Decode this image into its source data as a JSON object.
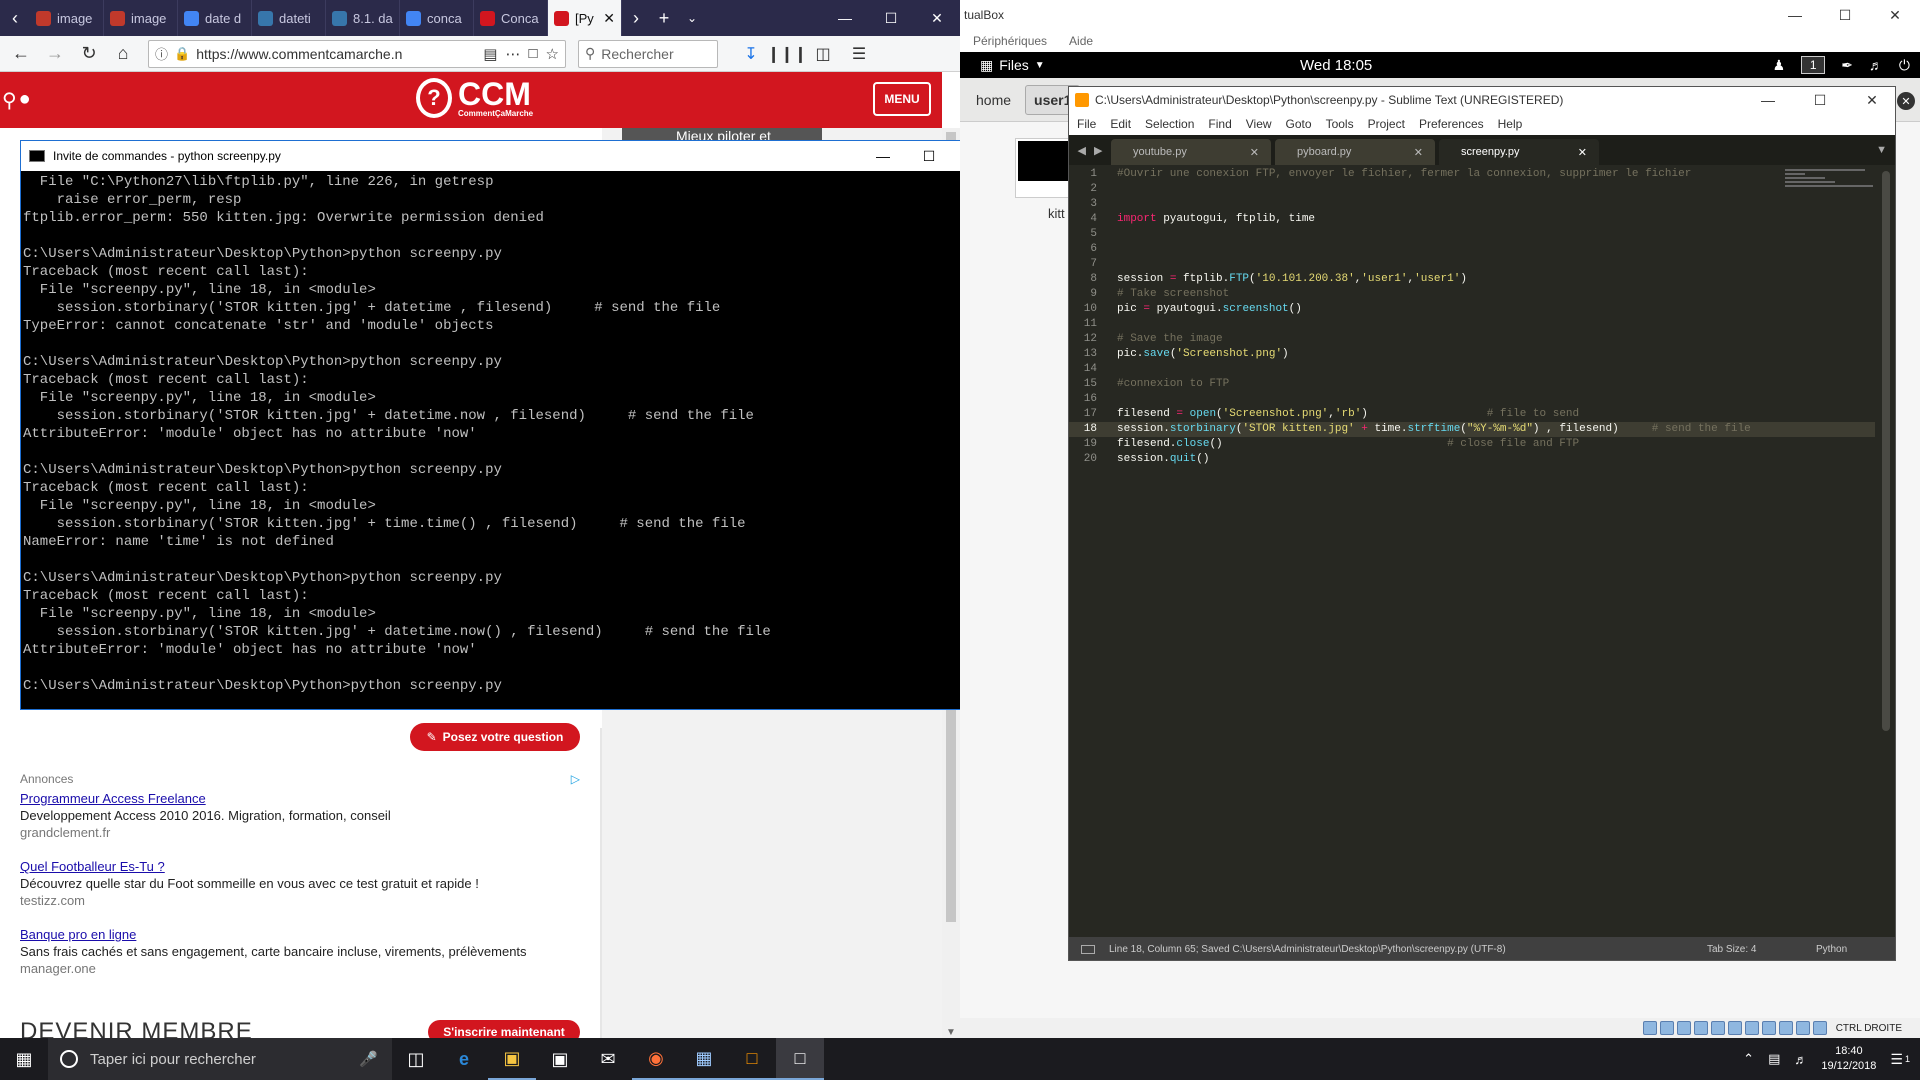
{
  "firefox": {
    "tabs": [
      {
        "label": "image",
        "color": "#c0392b"
      },
      {
        "label": "image",
        "color": "#c0392b"
      },
      {
        "label": "date d",
        "color": "#4285f4"
      },
      {
        "label": "dateti",
        "color": "#3776ab"
      },
      {
        "label": "8.1. da",
        "color": "#3776ab"
      },
      {
        "label": "conca",
        "color": "#4285f4"
      },
      {
        "label": "Conca",
        "color": "#d2161f"
      },
      {
        "label": "[Py",
        "color": "#d2161f",
        "active": true
      }
    ],
    "url": "https://www.commentcamarche.n",
    "search_placeholder": "Rechercher"
  },
  "ccm": {
    "brand": "CCM",
    "sub": "CommentÇaMarche",
    "menu_label": "MENU",
    "banner_text": "Mieux piloter et optimiser",
    "ask_button": "Posez votre question",
    "ads_label": "Annonces",
    "ads": [
      {
        "title": "Programmeur Access Freelance",
        "desc": "Developpement Access 2010 2016. Migration, formation, conseil",
        "url": "grandclement.fr"
      },
      {
        "title": "Quel Footballeur Es-Tu ?",
        "desc": "Découvrez quelle star du Foot sommeille en vous avec ce test gratuit et rapide !",
        "url": "testizz.com"
      },
      {
        "title": "Banque pro en ligne",
        "desc": "Sans frais cachés et sans engagement, carte bancaire incluse, virements, prélèvements",
        "url": "manager.one"
      }
    ],
    "devenir": "DEVENIR MEMBRE",
    "signup_button": "S'inscrire maintenant"
  },
  "cmd": {
    "title": "Invite de commandes - python  screenpy.py",
    "lines": [
      "  File \"C:\\Python27\\lib\\ftplib.py\", line 226, in getresp",
      "    raise error_perm, resp",
      "ftplib.error_perm: 550 kitten.jpg: Overwrite permission denied",
      "",
      "C:\\Users\\Administrateur\\Desktop\\Python>python screenpy.py",
      "Traceback (most recent call last):",
      "  File \"screenpy.py\", line 18, in <module>",
      "    session.storbinary('STOR kitten.jpg' + datetime , filesend)     # send the file",
      "TypeError: cannot concatenate 'str' and 'module' objects",
      "",
      "C:\\Users\\Administrateur\\Desktop\\Python>python screenpy.py",
      "Traceback (most recent call last):",
      "  File \"screenpy.py\", line 18, in <module>",
      "    session.storbinary('STOR kitten.jpg' + datetime.now , filesend)     # send the file",
      "AttributeError: 'module' object has no attribute 'now'",
      "",
      "C:\\Users\\Administrateur\\Desktop\\Python>python screenpy.py",
      "Traceback (most recent call last):",
      "  File \"screenpy.py\", line 18, in <module>",
      "    session.storbinary('STOR kitten.jpg' + time.time() , filesend)     # send the file",
      "NameError: name 'time' is not defined",
      "",
      "C:\\Users\\Administrateur\\Desktop\\Python>python screenpy.py",
      "Traceback (most recent call last):",
      "  File \"screenpy.py\", line 18, in <module>",
      "    session.storbinary('STOR kitten.jpg' + datetime.now() , filesend)     # send the file",
      "AttributeError: 'module' object has no attribute 'now'",
      "",
      "C:\\Users\\Administrateur\\Desktop\\Python>python screenpy.py"
    ]
  },
  "vbox": {
    "title": "tualBox",
    "menu": [
      "Périphériques",
      "Aide"
    ],
    "files_label": "Files",
    "clock": "Wed 18:05",
    "workspace": "1",
    "path": [
      "home",
      "user1"
    ],
    "thumb_label": "kitt",
    "status_text": "CTRL DROITE"
  },
  "sublime": {
    "title": "C:\\Users\\Administrateur\\Desktop\\Python\\screenpy.py - Sublime Text (UNREGISTERED)",
    "menu": [
      "File",
      "Edit",
      "Selection",
      "Find",
      "View",
      "Goto",
      "Tools",
      "Project",
      "Preferences",
      "Help"
    ],
    "tabs": [
      "youtube.py",
      "pyboard.py",
      "screenpy.py"
    ],
    "current_line": 18,
    "status": "Line 18, Column 65; Saved C:\\Users\\Administrateur\\Desktop\\Python\\screenpy.py (UTF-8)",
    "tab_size": "Tab Size: 4",
    "language": "Python"
  },
  "taskbar": {
    "search_placeholder": "Taper ici pour rechercher",
    "time": "18:40",
    "date": "19/12/2018",
    "notif_count": "1"
  }
}
